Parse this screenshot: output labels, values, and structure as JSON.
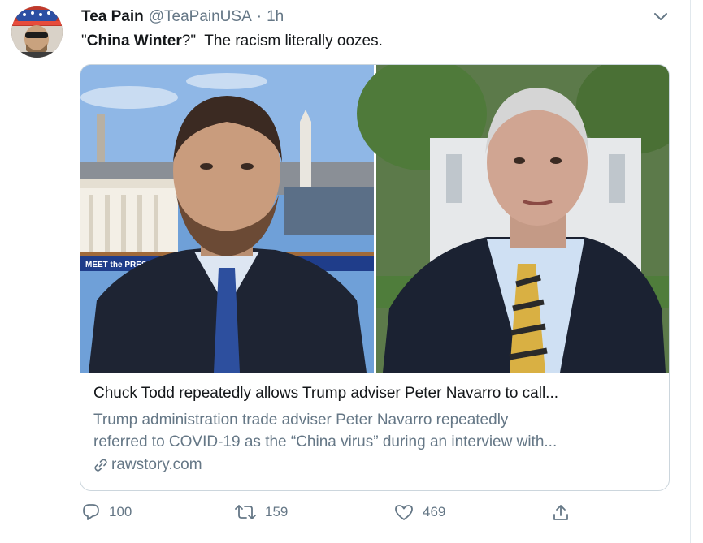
{
  "author": {
    "name": "Tea Pain",
    "handle": "@TeaPainUSA",
    "separator": "·",
    "time": "1h"
  },
  "tweet": {
    "quote_open": "\"",
    "bold_text": "China Winter",
    "rest_text": "?\"  The racism literally oozes."
  },
  "card": {
    "image_captions": {
      "left_banner": "MEET the PRESS"
    },
    "title": "Chuck Todd repeatedly allows Trump adviser Peter Navarro to call...",
    "description_line1": "Trump administration trade adviser Peter Navarro repeatedly",
    "description_line2": "referred to COVID-19 as the “China virus” during an interview with...",
    "domain": "rawstory.com",
    "link_icon": "link-icon"
  },
  "actions": {
    "reply_count": "100",
    "retweet_count": "159",
    "like_count": "469",
    "reply_icon": "reply-icon",
    "retweet_icon": "retweet-icon",
    "like_icon": "heart-icon",
    "share_icon": "share-icon"
  },
  "colors": {
    "text_primary": "#14171a",
    "text_secondary": "#657786",
    "border": "#ccd6dd"
  }
}
